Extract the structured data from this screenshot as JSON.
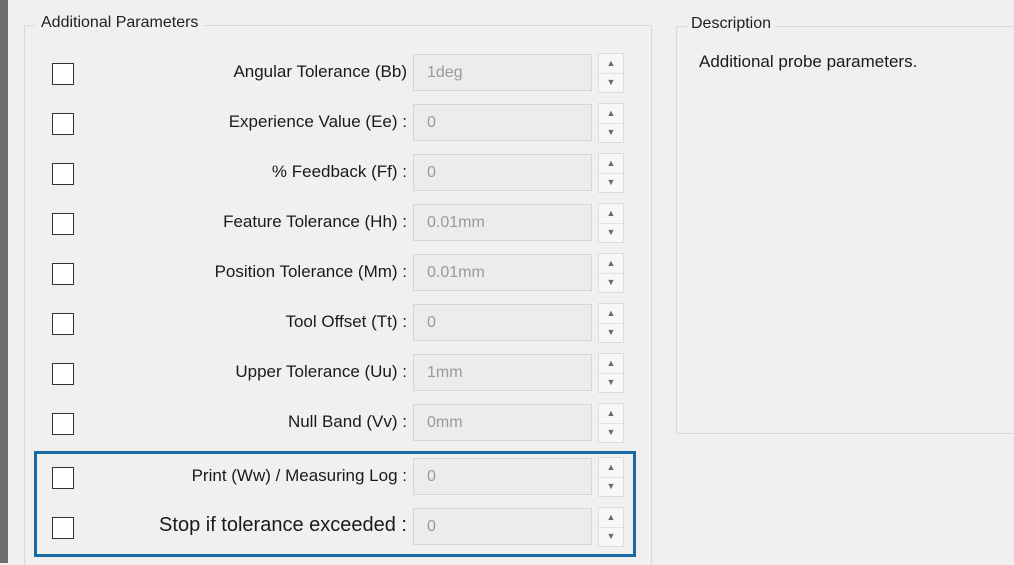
{
  "additional_parameters": {
    "title": "Additional Parameters",
    "rows": [
      {
        "label": "Angular Tolerance (Bb)",
        "value": "1deg"
      },
      {
        "label": "Experience Value (Ee) :",
        "value": "0"
      },
      {
        "label": "% Feedback (Ff) :",
        "value": "0"
      },
      {
        "label": "Feature Tolerance (Hh) :",
        "value": "0.01mm"
      },
      {
        "label": "Position Tolerance (Mm) :",
        "value": "0.01mm"
      },
      {
        "label": "Tool Offset (Tt) :",
        "value": "0"
      },
      {
        "label": "Upper Tolerance (Uu) :",
        "value": "1mm"
      },
      {
        "label": "Null Band (Vv) :",
        "value": "0mm"
      },
      {
        "label": "Print (Ww) / Measuring Log :",
        "value": "0"
      },
      {
        "label": "Stop if tolerance exceeded :",
        "value": "0"
      }
    ]
  },
  "description": {
    "title": "Description",
    "text": "Additional probe parameters."
  },
  "icons": {
    "spin_up": "caret-up-icon",
    "spin_down": "caret-down-icon"
  },
  "colors": {
    "highlight": "#1a6aa6",
    "background": "#f0f0f0"
  }
}
